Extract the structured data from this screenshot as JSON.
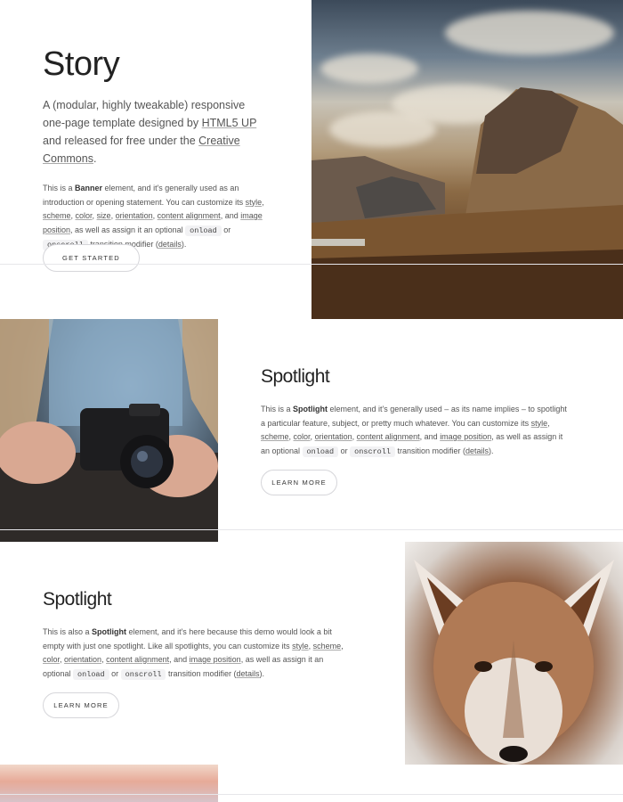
{
  "banner": {
    "title": "Story",
    "major_pre": "A (modular, highly tweakable) responsive one-page template designed by ",
    "major_link1": "HTML5 UP",
    "major_mid": " and released for free under the ",
    "major_link2": "Creative Commons",
    "major_end": ".",
    "p_pre": "This is a ",
    "p_bold": "Banner",
    "p_mid": " element, and it's generally used as an introduction or opening statement. You can customize its ",
    "links": [
      "style",
      "scheme",
      "color",
      "size",
      "orientation",
      "content alignment",
      "image position"
    ],
    "p_tail1": ", as well as assign it an optional ",
    "code1": "onload",
    "or": " or ",
    "code2": "onscroll",
    "p_tail2": " transition modifier (",
    "details": "details",
    "close": ").",
    "button": "Get Started"
  },
  "spotlight1": {
    "title": "Spotlight",
    "p_pre": "This is a ",
    "p_bold": "Spotlight",
    "p_mid": " element, and it's generally used – as its name implies – to spotlight a particular feature, subject, or pretty much whatever. You can customize its ",
    "links": [
      "style",
      "scheme",
      "color",
      "orientation",
      "content alignment",
      "image position"
    ],
    "p_tail1": ", as well as assign it an optional ",
    "code1": "onload",
    "or": " or ",
    "code2": "onscroll",
    "p_tail2": " transition modifier (",
    "details": "details",
    "close": ").",
    "button": "Learn More"
  },
  "spotlight2": {
    "title": "Spotlight",
    "p_pre": "This is also a ",
    "p_bold": "Spotlight",
    "p_mid": " element, and it's here because this demo would look a bit empty with just one spotlight. Like all spotlights, you can customize its ",
    "links": [
      "style",
      "scheme",
      "color",
      "orientation",
      "content alignment",
      "image position"
    ],
    "p_tail1": ", as well as assign it an optional ",
    "code1": "onload",
    "or": " or ",
    "code2": "onscroll",
    "p_tail2": " transition modifier (",
    "details": "details",
    "close": ").",
    "button": "Learn More"
  },
  "images": {
    "banner": "mountain-landscape-image",
    "spotlight1": "camera-hands-image",
    "spotlight2": "coyote-image",
    "next": "sunset-sky-image"
  }
}
